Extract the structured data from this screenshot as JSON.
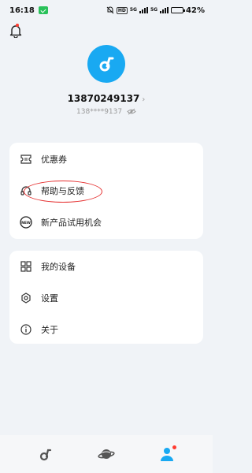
{
  "status_bar": {
    "time": "16:18",
    "hd": "HD",
    "net1": "5G",
    "net2": "5G",
    "battery_pct": "42",
    "battery_level": 0.42
  },
  "profile": {
    "username": "13870249137",
    "masked_phone": "138****9137"
  },
  "menu_group_1": [
    {
      "label": "优惠券",
      "icon": "coupon-icon"
    },
    {
      "label": "帮助与反馈",
      "icon": "headset-icon"
    },
    {
      "label": "新产品试用机会",
      "icon": "new-badge-icon",
      "badge": "NEW"
    }
  ],
  "menu_group_2": [
    {
      "label": "我的设备",
      "icon": "devices-grid-icon"
    },
    {
      "label": "设置",
      "icon": "gear-icon"
    },
    {
      "label": "关于",
      "icon": "info-icon"
    }
  ],
  "bottom_nav": [
    {
      "icon": "home-logo-icon"
    },
    {
      "icon": "planet-icon"
    },
    {
      "icon": "profile-icon",
      "active": true
    }
  ],
  "colors": {
    "accent": "#19a9f2",
    "background": "#f0f3f7",
    "annotation": "#e53030",
    "badge_dot": "#ff3b30"
  }
}
